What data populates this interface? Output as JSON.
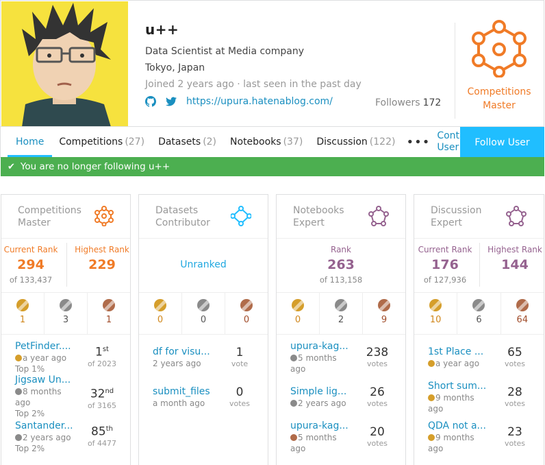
{
  "user": {
    "name": "u++",
    "bio": "Data Scientist at Media company",
    "location": "Tokyo, Japan",
    "joined": "Joined 2 years ago · last seen in the past day",
    "blog_url": "https://upura.hatenablog.com/",
    "followers_label": "Followers",
    "followers_count": "172",
    "tier": "Competitions Master"
  },
  "nav": {
    "tabs": [
      {
        "label": "Home",
        "count": ""
      },
      {
        "label": "Competitions",
        "count": "(27)"
      },
      {
        "label": "Datasets",
        "count": "(2)"
      },
      {
        "label": "Notebooks",
        "count": "(37)"
      },
      {
        "label": "Discussion",
        "count": "(122)"
      }
    ],
    "more": "•••",
    "contact": "Contact User",
    "follow": "Follow User"
  },
  "banner": {
    "text": "You are no longer following u++"
  },
  "cards": {
    "competitions": {
      "title": "Competitions Master",
      "current_label": "Current Rank",
      "current": "294",
      "current_of": "of 133,437",
      "highest_label": "Highest Rank",
      "highest": "229",
      "medals": {
        "gold": "1",
        "silver": "3",
        "bronze": "1"
      },
      "items": [
        {
          "title": "PetFinder....",
          "time": "a year ago",
          "extra": "Top 1%",
          "rank": "1",
          "suffix": "st",
          "of": "of 2023"
        },
        {
          "title": "Jigsaw Un...",
          "time": "8 months ago",
          "extra": "Top 2%",
          "rank": "32",
          "suffix": "nd",
          "of": "of 3165"
        },
        {
          "title": "Santander...",
          "time": "2 years ago",
          "extra": "Top 2%",
          "rank": "85",
          "suffix": "th",
          "of": "of 4477"
        }
      ]
    },
    "datasets": {
      "title": "Datasets Contributor",
      "rank": "Unranked",
      "medals": {
        "gold": "0",
        "silver": "0",
        "bronze": "0"
      },
      "items": [
        {
          "title": "df for visu...",
          "time": "2 years ago",
          "votes": "1",
          "votes_label": "vote"
        },
        {
          "title": "submit_files",
          "time": "a month ago",
          "votes": "0",
          "votes_label": "votes"
        }
      ]
    },
    "notebooks": {
      "title": "Notebooks Expert",
      "rank_label": "Rank",
      "rank": "263",
      "rank_of": "of 113,158",
      "medals": {
        "gold": "0",
        "silver": "2",
        "bronze": "9"
      },
      "items": [
        {
          "title": "upura-kag...",
          "time": "5 months ago",
          "votes": "238",
          "votes_label": "votes"
        },
        {
          "title": "Simple lig...",
          "time": "2 years ago",
          "votes": "26",
          "votes_label": "votes"
        },
        {
          "title": "upura-kag...",
          "time": "5 months ago",
          "votes": "20",
          "votes_label": "votes"
        }
      ]
    },
    "discussion": {
      "title": "Discussion Expert",
      "current_label": "Current Rank",
      "current": "176",
      "current_of": "of 127,936",
      "highest_label": "Highest Rank",
      "highest": "144",
      "medals": {
        "gold": "10",
        "silver": "6",
        "bronze": "64"
      },
      "items": [
        {
          "title": "1st Place ...",
          "time": "a year ago",
          "votes": "65",
          "votes_label": "votes"
        },
        {
          "title": "Short sum...",
          "time": "9 months ago",
          "votes": "28",
          "votes_label": "votes"
        },
        {
          "title": "QDA not a...",
          "time": "9 months ago",
          "votes": "23",
          "votes_label": "votes"
        }
      ]
    }
  },
  "colors": {
    "accent": "#20beff",
    "competitions": "#f07b27",
    "notebooks": "#95628f",
    "banner": "#4caf50"
  }
}
